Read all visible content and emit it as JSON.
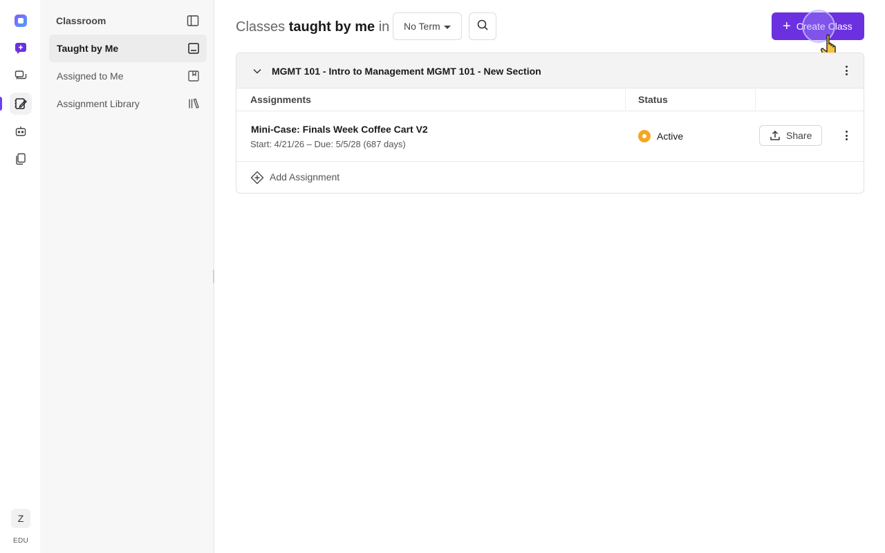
{
  "rail": {
    "items": [
      {
        "icon": "app-logo-icon"
      },
      {
        "icon": "new-chat-icon"
      },
      {
        "icon": "chats-icon"
      },
      {
        "icon": "classroom-icon",
        "active": true
      },
      {
        "icon": "bot-icon"
      },
      {
        "icon": "copy-icon"
      }
    ],
    "avatar_letter": "Z",
    "plan_label": "EDU",
    "accent_color": "#6b3df5"
  },
  "sidebar": {
    "header": "Classroom",
    "items": [
      {
        "label": "Taught by Me",
        "icon": "tablet-icon",
        "active": true
      },
      {
        "label": "Assigned to Me",
        "icon": "bookmark-icon",
        "active": false
      },
      {
        "label": "Assignment Library",
        "icon": "library-icon",
        "active": false
      }
    ]
  },
  "header": {
    "title_prefix": "Classes",
    "title_bold": "taught by me",
    "title_suffix": "in",
    "term_select": "No Term",
    "create_label": "Create Class",
    "create_color": "#6b30e0"
  },
  "class_card": {
    "name": "MGMT 101 - Intro to Management MGMT 101 - New Section",
    "columns": {
      "assignments": "Assignments",
      "status": "Status"
    },
    "assignments": [
      {
        "title": "Mini-Case: Finals Week Coffee Cart V2",
        "dates": "Start: 4/21/26 – Due: 5/5/28 (687 days)",
        "status": "Active",
        "status_color": "#f5a623",
        "share_label": "Share"
      }
    ],
    "add_label": "Add Assignment"
  }
}
